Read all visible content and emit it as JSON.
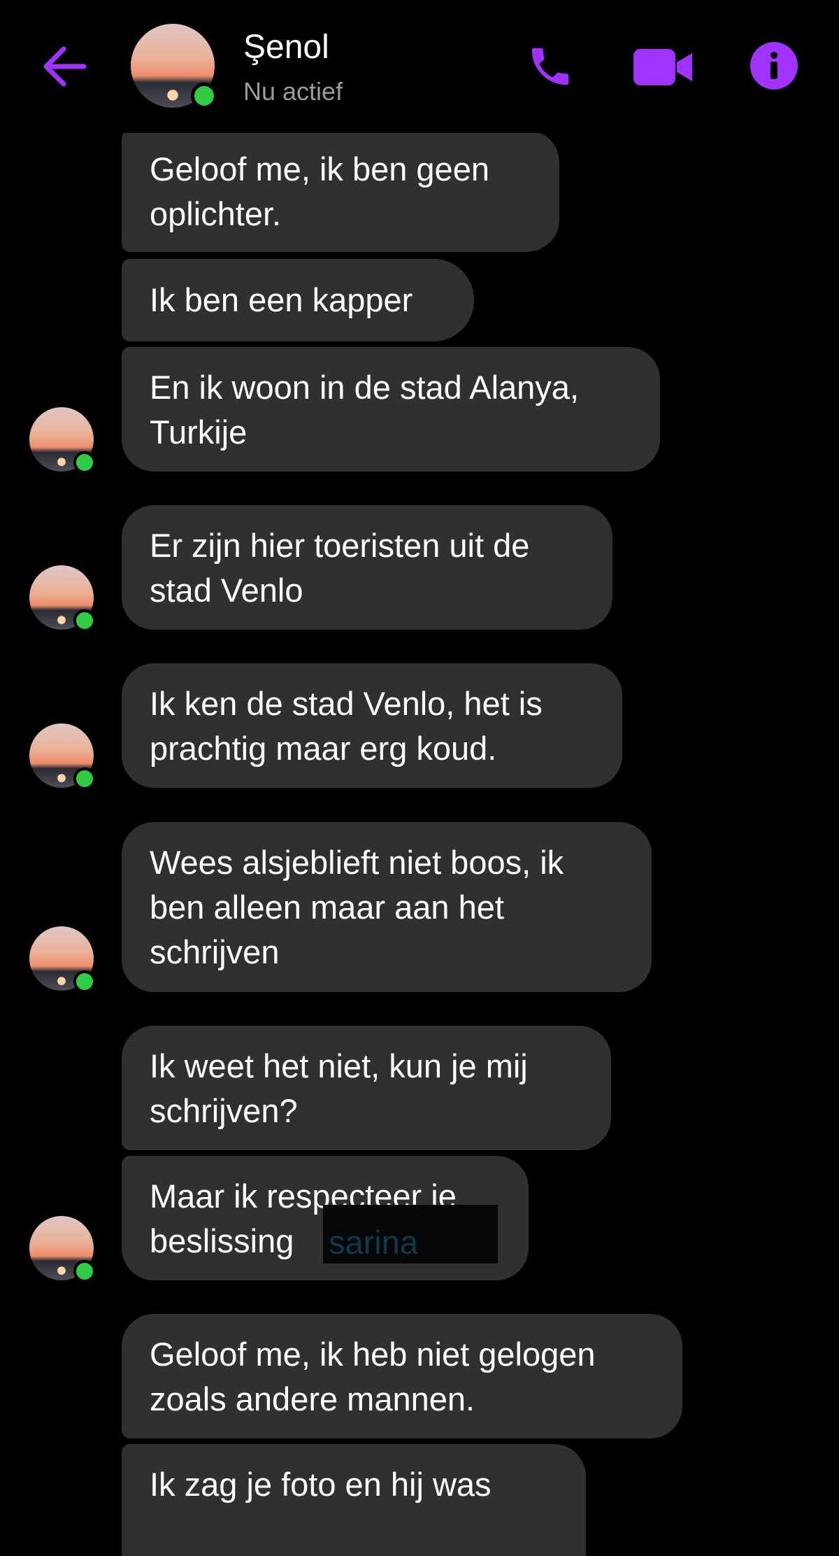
{
  "header": {
    "contact_name": "Şenol",
    "status": "Nu actief",
    "accent_color": "#a033ff",
    "icons": [
      "back-arrow-icon",
      "phone-icon",
      "video-camera-icon",
      "info-icon"
    ]
  },
  "messages": [
    {
      "text": "Geloof me, ik ben geen\noplichter."
    },
    {
      "text": "Ik ben een kapper"
    },
    {
      "text": "En ik woon in de stad Alanya,\nTurkije"
    },
    {
      "text": "Er zijn hier toeristen uit de\nstad Venlo"
    },
    {
      "text": "Ik ken de stad Venlo, het is\nprachtig maar erg koud."
    },
    {
      "text": "Wees alsjeblieft niet boos, ik\nben alleen maar aan het\nschrijven"
    },
    {
      "text": "Ik weet het niet, kun je mij\nschrijven?"
    },
    {
      "text": "Maar ik respecteer je\nbeslissing"
    },
    {
      "text": "Geloof me, ik heb niet gelogen\nzoals andere mannen."
    },
    {
      "text": "Ik zag je foto en hij was"
    }
  ],
  "redaction": {
    "visible_text": "sarina"
  },
  "colors": {
    "background": "#000000",
    "bubble": "#303030",
    "online": "#31cc46",
    "muted_text": "#9b9b9b"
  }
}
